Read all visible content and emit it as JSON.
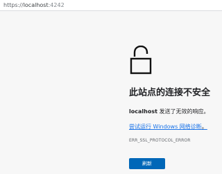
{
  "browser": {
    "url_scheme": "https://",
    "url_host": "localhost",
    "url_port": ":4242"
  },
  "error_page": {
    "icon": "unlocked-padlock-icon",
    "title": "此站点的连接不安全",
    "message_host": "localhost",
    "message_text": " 发送了无效的响应。",
    "diagnostics_link": "尝试运行 Windows 网络诊断",
    "diagnostics_period": "。",
    "error_code": "ERR_SSL_PROTOCOL_ERROR",
    "refresh_label": "刷新"
  },
  "colors": {
    "background": "#f7f7f7",
    "primary_button": "#0067b8",
    "link": "#1a73e8",
    "text": "#202124"
  }
}
